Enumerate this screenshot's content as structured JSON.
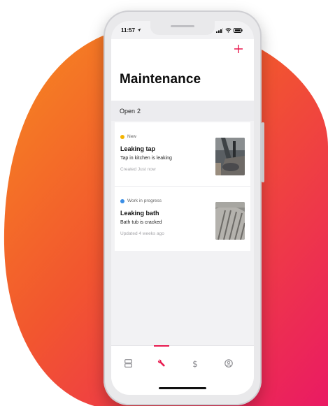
{
  "colors": {
    "accent": "#e8194e",
    "blob_orange": "#f57d1f",
    "blob_pink": "#ee1f5f",
    "status_new": "#f4b400",
    "status_in_progress": "#3a8ee6"
  },
  "status_bar": {
    "time": "11:57",
    "icons": [
      "location-arrow-icon",
      "signal-icon",
      "wifi-icon",
      "battery-icon"
    ]
  },
  "header": {
    "title": "Maintenance",
    "add_icon": "plus-icon"
  },
  "section": {
    "label": "Open",
    "count": "2"
  },
  "items": [
    {
      "status": "New",
      "status_color": "#f4b400",
      "title": "Leaking tap",
      "description": "Tap in kitchen is leaking",
      "meta": "Created Just now",
      "thumbnail": "kitchen-tap-photo"
    },
    {
      "status": "Work in progress",
      "status_color": "#3a8ee6",
      "title": "Leaking bath",
      "description": "Bath tub is cracked",
      "meta": "Updated 4 weeks ago",
      "thumbnail": "bath-tub-photo"
    }
  ],
  "tab_bar": {
    "tabs": [
      {
        "icon": "properties-icon",
        "active": false
      },
      {
        "icon": "wrench-icon",
        "active": true
      },
      {
        "icon": "dollar-icon",
        "active": false
      },
      {
        "icon": "profile-icon",
        "active": false
      }
    ]
  }
}
